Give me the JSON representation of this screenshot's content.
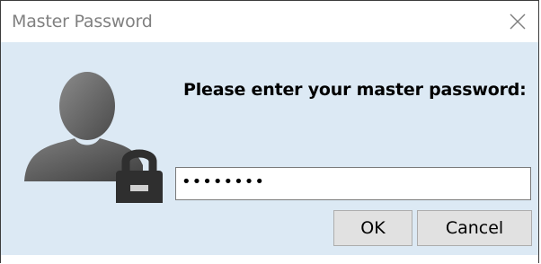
{
  "window": {
    "title": "Master Password",
    "close_symbol": "×"
  },
  "prompt": {
    "text": "Please enter your master password:"
  },
  "password_field": {
    "masked_value": "••••••••"
  },
  "buttons": {
    "ok_label": "OK",
    "cancel_label": "Cancel"
  },
  "icons": {
    "avatar": "user-lock-icon",
    "close": "close-icon"
  },
  "colors": {
    "content_background": "#dce9f4",
    "button_face": "#e1e1e1"
  }
}
